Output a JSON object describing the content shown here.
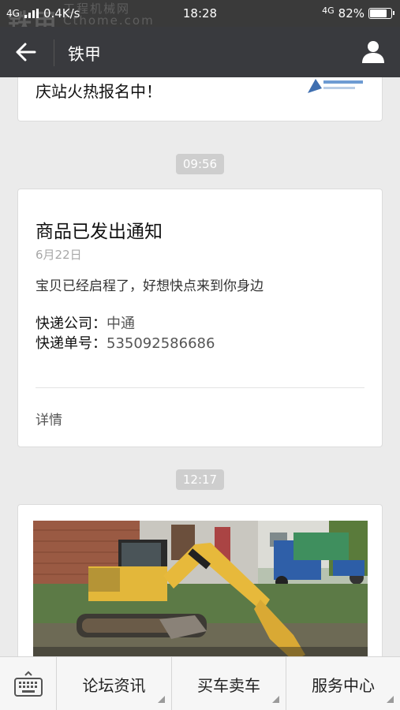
{
  "status_bar": {
    "signal": "4G",
    "speed": "0.4K/s",
    "time": "18:28",
    "network": "4G",
    "battery": "82%",
    "battery_level": 0.82,
    "watermark": "铁甲",
    "watermark_site": "工程机械网",
    "watermark_url": "Cthome.com"
  },
  "header": {
    "title": "铁甲",
    "back_icon": "arrow-left-icon",
    "profile_icon": "person-icon"
  },
  "messages": [
    {
      "type": "partial-card",
      "text": "庆站火热报名中！"
    },
    {
      "type": "timestamp",
      "time": "09:56"
    },
    {
      "type": "notification-card",
      "title": "商品已发出通知",
      "date": "6月22日",
      "description": "宝贝已经启程了，好想快点来到你身边",
      "courier_label": "快递公司：",
      "courier": "中通",
      "tracking_label": "快递单号：",
      "tracking_number": "535092586686",
      "detail_link": "详情"
    },
    {
      "type": "timestamp",
      "time": "12:17"
    },
    {
      "type": "image-card",
      "image": "excavator-photo"
    }
  ],
  "tab_bar": {
    "keyboard_icon": "keyboard-icon",
    "tabs": [
      {
        "label": "论坛资讯"
      },
      {
        "label": "买车卖车"
      },
      {
        "label": "服务中心"
      }
    ]
  },
  "colors": {
    "nav_bg": "#393a3e",
    "status_bg": "#3a3a3a",
    "page_bg": "#ebebeb",
    "card_bg": "#ffffff",
    "timestamp_bg": "#cecece"
  }
}
